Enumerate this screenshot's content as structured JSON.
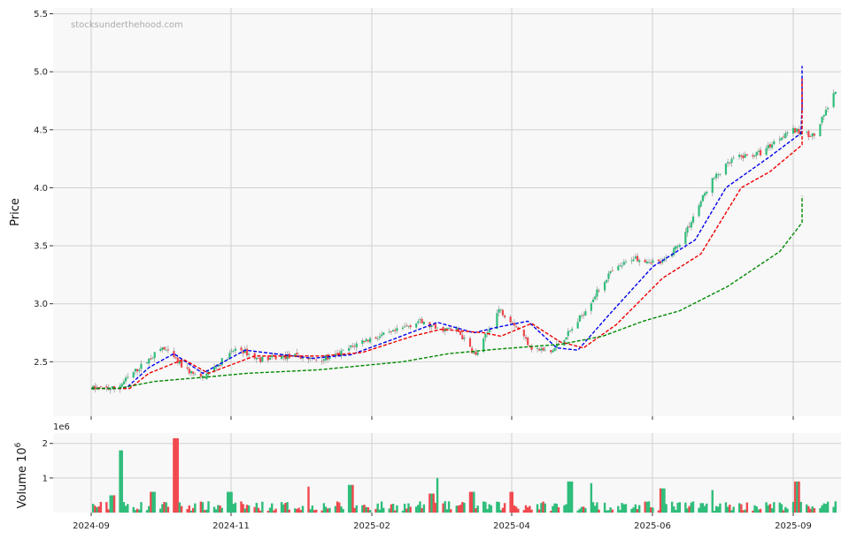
{
  "watermark": "stocksunderthehood.com",
  "colors": {
    "up": "#2ebd7a",
    "down": "#f0484e",
    "ma_fast": "#0000ee",
    "ma_mid": "#ee0000",
    "ma_slow": "#008800",
    "grid": "#d0d0d0",
    "panel": "#f8f8f8"
  },
  "chart_data": [
    {
      "type": "candlestick",
      "ylabel": "Price",
      "ylim": [
        2.03,
        5.55
      ],
      "yticks": [
        2.5,
        3.0,
        3.5,
        4.0,
        4.5,
        5.0,
        5.5
      ],
      "xticks": [
        "2024-09",
        "2024-11",
        "2025-02",
        "2025-04",
        "2025-06",
        "2025-09"
      ],
      "xrange": [
        "2024-08-19",
        "2025-09-14"
      ],
      "grid": true,
      "anchors": [
        [
          "2024-09-01",
          2.27
        ],
        [
          "2024-09-14",
          2.27
        ],
        [
          "2024-09-24",
          2.42
        ],
        [
          "2024-10-08",
          2.62
        ],
        [
          "2024-10-19",
          2.45
        ],
        [
          "2024-10-28",
          2.35
        ],
        [
          "2024-11-16",
          2.62
        ],
        [
          "2024-11-27",
          2.52
        ],
        [
          "2024-12-15",
          2.55
        ],
        [
          "2024-12-25",
          2.52
        ],
        [
          "2025-01-05",
          2.54
        ],
        [
          "2025-01-20",
          2.68
        ],
        [
          "2025-02-05",
          2.75
        ],
        [
          "2025-02-18",
          2.85
        ],
        [
          "2025-02-28",
          2.78
        ],
        [
          "2025-03-10",
          2.78
        ],
        [
          "2025-03-20",
          2.55
        ],
        [
          "2025-04-01",
          2.95
        ],
        [
          "2025-04-08",
          2.85
        ],
        [
          "2025-04-18",
          2.62
        ],
        [
          "2025-04-28",
          2.58
        ],
        [
          "2025-05-10",
          2.8
        ],
        [
          "2025-05-28",
          3.25
        ],
        [
          "2025-06-10",
          3.4
        ],
        [
          "2025-06-25",
          3.35
        ],
        [
          "2025-07-05",
          3.55
        ],
        [
          "2025-07-20",
          4.05
        ],
        [
          "2025-08-01",
          4.25
        ],
        [
          "2025-08-15",
          4.3
        ],
        [
          "2025-08-30",
          4.5
        ],
        [
          "2025-09-12",
          4.45
        ],
        [
          "2025-09-25",
          4.9
        ],
        [
          "2025-10-02",
          4.7
        ],
        [
          "2025-10-10",
          5.2
        ]
      ],
      "series": [
        {
          "name": "",
          "style": "dashed",
          "color": "#0000ee",
          "values": [
            [
              "2024-09-01",
              2.27
            ],
            [
              "2024-09-19",
              2.27
            ],
            [
              "2024-10-01",
              2.45
            ],
            [
              "2024-10-14",
              2.57
            ],
            [
              "2024-10-29",
              2.4
            ],
            [
              "2024-11-20",
              2.6
            ],
            [
              "2024-12-25",
              2.53
            ],
            [
              "2025-01-14",
              2.56
            ],
            [
              "2025-02-06",
              2.7
            ],
            [
              "2025-02-28",
              2.84
            ],
            [
              "2025-03-19",
              2.75
            ],
            [
              "2025-04-01",
              2.8
            ],
            [
              "2025-04-16",
              2.85
            ],
            [
              "2025-05-01",
              2.62
            ],
            [
              "2025-05-12",
              2.6
            ],
            [
              "2025-05-28",
              2.9
            ],
            [
              "2025-06-20",
              3.32
            ],
            [
              "2025-07-12",
              3.55
            ],
            [
              "2025-07-28",
              4.0
            ],
            [
              "2025-08-20",
              4.27
            ],
            [
              "2025-09-05",
              4.47
            ],
            [
              "2025-09-20",
              4.7
            ],
            [
              "2025-09-27",
              4.75
            ],
            [
              "2025-10-01",
              4.67
            ],
            [
              "2025-10-10",
              4.9
            ],
            [
              "2025-10-18",
              5.05
            ]
          ]
        },
        {
          "name": "",
          "style": "dashed",
          "color": "#ee0000",
          "values": [
            [
              "2024-09-01",
              2.27
            ],
            [
              "2024-09-21",
              2.27
            ],
            [
              "2024-10-01",
              2.4
            ],
            [
              "2024-10-19",
              2.52
            ],
            [
              "2024-11-01",
              2.4
            ],
            [
              "2024-11-25",
              2.55
            ],
            [
              "2024-12-30",
              2.55
            ],
            [
              "2025-01-20",
              2.58
            ],
            [
              "2025-02-15",
              2.72
            ],
            [
              "2025-03-02",
              2.78
            ],
            [
              "2025-03-24",
              2.75
            ],
            [
              "2025-04-02",
              2.72
            ],
            [
              "2025-04-18",
              2.83
            ],
            [
              "2025-05-03",
              2.67
            ],
            [
              "2025-05-15",
              2.62
            ],
            [
              "2025-06-01",
              2.82
            ],
            [
              "2025-06-25",
              3.22
            ],
            [
              "2025-07-15",
              3.43
            ],
            [
              "2025-08-05",
              4.0
            ],
            [
              "2025-08-20",
              4.14
            ],
            [
              "2025-09-08",
              4.37
            ],
            [
              "2025-09-22",
              4.58
            ],
            [
              "2025-10-02",
              4.65
            ],
            [
              "2025-10-10",
              4.8
            ],
            [
              "2025-10-18",
              4.94
            ]
          ]
        },
        {
          "name": "",
          "style": "dashed",
          "color": "#008800",
          "values": [
            [
              "2024-09-01",
              2.27
            ],
            [
              "2024-09-15",
              2.27
            ],
            [
              "2024-10-04",
              2.33
            ],
            [
              "2024-11-01",
              2.37
            ],
            [
              "2024-11-21",
              2.4
            ],
            [
              "2024-12-28",
              2.43
            ],
            [
              "2025-02-10",
              2.5
            ],
            [
              "2025-03-06",
              2.57
            ],
            [
              "2025-04-01",
              2.61
            ],
            [
              "2025-05-03",
              2.65
            ],
            [
              "2025-05-25",
              2.72
            ],
            [
              "2025-06-15",
              2.85
            ],
            [
              "2025-07-04",
              2.94
            ],
            [
              "2025-07-29",
              3.15
            ],
            [
              "2025-08-25",
              3.45
            ],
            [
              "2025-09-20",
              3.7
            ],
            [
              "2025-10-05",
              3.82
            ],
            [
              "2025-10-18",
              3.93
            ]
          ]
        }
      ]
    },
    {
      "type": "bar",
      "ylabel": "Volume  10",
      "ylabel_exp": "6",
      "offset_label": "1e6",
      "ylim": [
        0,
        2.3
      ],
      "yticks": [
        1,
        2
      ],
      "units": "millions",
      "spikes": [
        [
          "2024-09-12",
          0.5
        ],
        [
          "2024-09-16",
          1.8
        ],
        [
          "2024-10-03",
          0.6
        ],
        [
          "2024-10-15",
          2.15
        ],
        [
          "2024-11-12",
          0.6
        ],
        [
          "2024-12-22",
          0.75
        ],
        [
          "2025-01-14",
          0.8
        ],
        [
          "2025-02-25",
          0.55
        ],
        [
          "2025-03-01",
          1.0
        ],
        [
          "2025-03-18",
          0.6
        ],
        [
          "2025-04-07",
          0.6
        ],
        [
          "2025-05-08",
          0.9
        ],
        [
          "2025-05-18",
          0.85
        ],
        [
          "2025-06-25",
          0.7
        ],
        [
          "2025-07-20",
          0.65
        ],
        [
          "2025-09-03",
          0.9
        ],
        [
          "2025-10-02",
          0.65
        ]
      ]
    }
  ]
}
